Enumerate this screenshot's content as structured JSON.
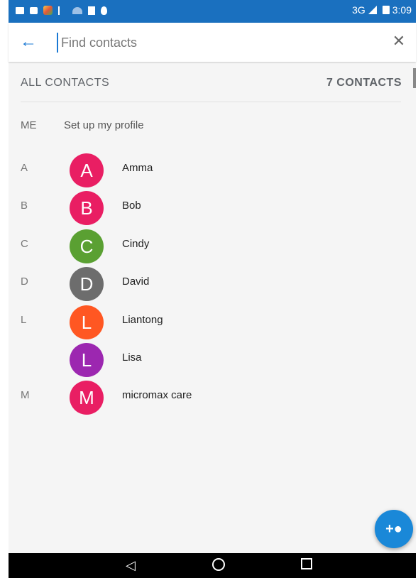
{
  "status_bar": {
    "network": "3G",
    "time": "3:09",
    "icons": [
      "image-icon",
      "lock-icon",
      "app-icon",
      "usb-icon",
      "wifi-icon",
      "file-icon",
      "drop-icon"
    ]
  },
  "search": {
    "placeholder": "Find contacts",
    "value": ""
  },
  "list_header": {
    "title": "ALL CONTACTS",
    "count": "7 CONTACTS"
  },
  "me": {
    "label": "ME",
    "text": "Set up my profile"
  },
  "contacts": [
    {
      "letter": "A",
      "initial": "A",
      "name": "Amma",
      "color": "#e91e63"
    },
    {
      "letter": "B",
      "initial": "B",
      "name": "Bob",
      "color": "#e91e63"
    },
    {
      "letter": "C",
      "initial": "C",
      "name": "Cindy",
      "color": "#5aa032"
    },
    {
      "letter": "D",
      "initial": "D",
      "name": "David",
      "color": "#6d6d6d"
    },
    {
      "letter": "L",
      "initial": "L",
      "name": "Liantong",
      "color": "#ff5722"
    },
    {
      "letter": "",
      "initial": "L",
      "name": "Lisa",
      "color": "#9c27b0"
    },
    {
      "letter": "M",
      "initial": "M",
      "name": "micromax care",
      "color": "#e91e63"
    }
  ],
  "colors": {
    "status_bar": "#1a70bf",
    "accent": "#1a78d3",
    "fab": "#1a88d8"
  }
}
